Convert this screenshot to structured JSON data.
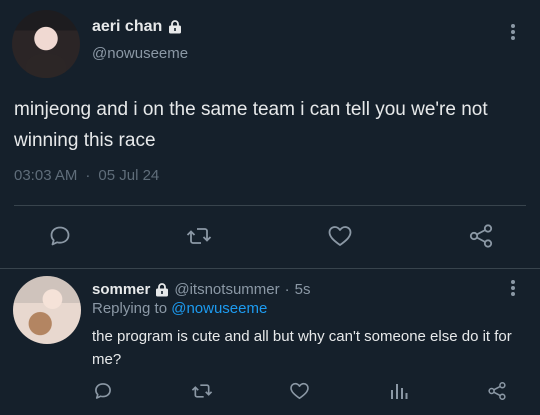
{
  "post": {
    "display_name": "aeri chan",
    "handle": "@nowuseeme",
    "text": "minjeong and i on the same team i can tell you we're not winning this race",
    "time": "03:03 AM",
    "dot": "·",
    "date": "05 Jul 24"
  },
  "actions": {
    "icons": [
      "reply-icon",
      "retweet-icon",
      "like-icon",
      "share-icon"
    ]
  },
  "reply": {
    "display_name": "sommer",
    "handle": "@itsnotsummer",
    "separator": "·",
    "age": "5s",
    "replying_prefix": "Replying to",
    "replying_to": "@nowuseeme",
    "text": "the program is cute and all but why can't someone else do it for me?",
    "icons": [
      "reply-icon",
      "retweet-icon",
      "like-icon",
      "views-icon",
      "share-icon"
    ]
  },
  "colors": {
    "background": "#15202b",
    "text": "#e7e9ea",
    "muted": "#8b98a5",
    "accent": "#1d9bf0",
    "divider": "#38444d"
  }
}
